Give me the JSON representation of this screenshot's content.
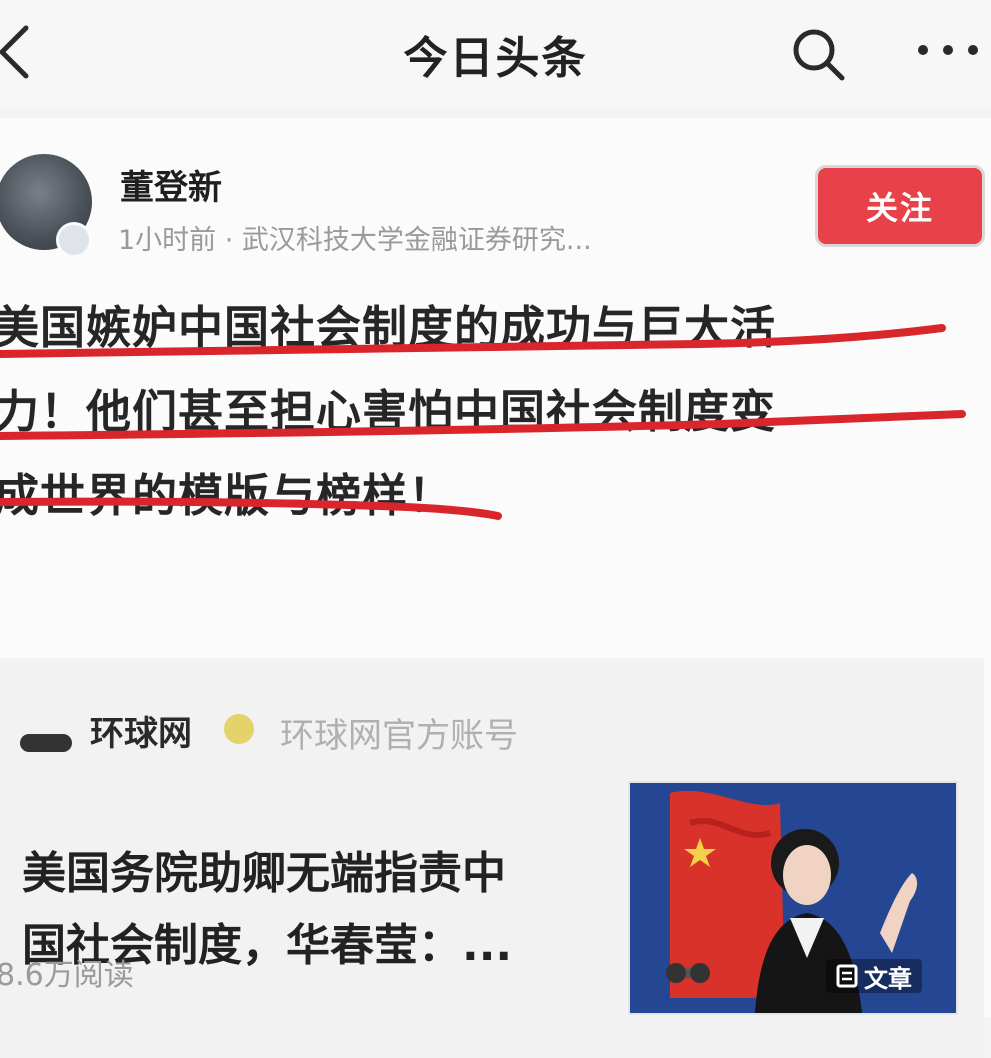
{
  "header": {
    "title": "今日头条"
  },
  "post": {
    "author_name": "董登新",
    "meta": "1小时前 · 武汉科技大学金融证券研究...",
    "follow_label": "关注",
    "headline_lines": [
      "美国嫉妒中国社会制度的成功与巨大活",
      "力！他们甚至担心害怕中国社会制度变",
      "成世界的模版与榜样！"
    ],
    "read_count": "8.6万阅读"
  },
  "embed": {
    "source_name": "环球网",
    "source_desc": "环球网官方账号",
    "title_lines": [
      "美国务院助卿无端指责中",
      "国社会制度，华春莹：..."
    ],
    "thumb_badge": "文章"
  },
  "colors": {
    "accent_red": "#e9414a",
    "underline_red": "#d9262b",
    "thumb_blue": "#1f3f8a",
    "flag_red": "#d8322a"
  },
  "icons": [
    "back-icon",
    "search-icon",
    "more-icon",
    "verified-icon",
    "doc-icon"
  ]
}
